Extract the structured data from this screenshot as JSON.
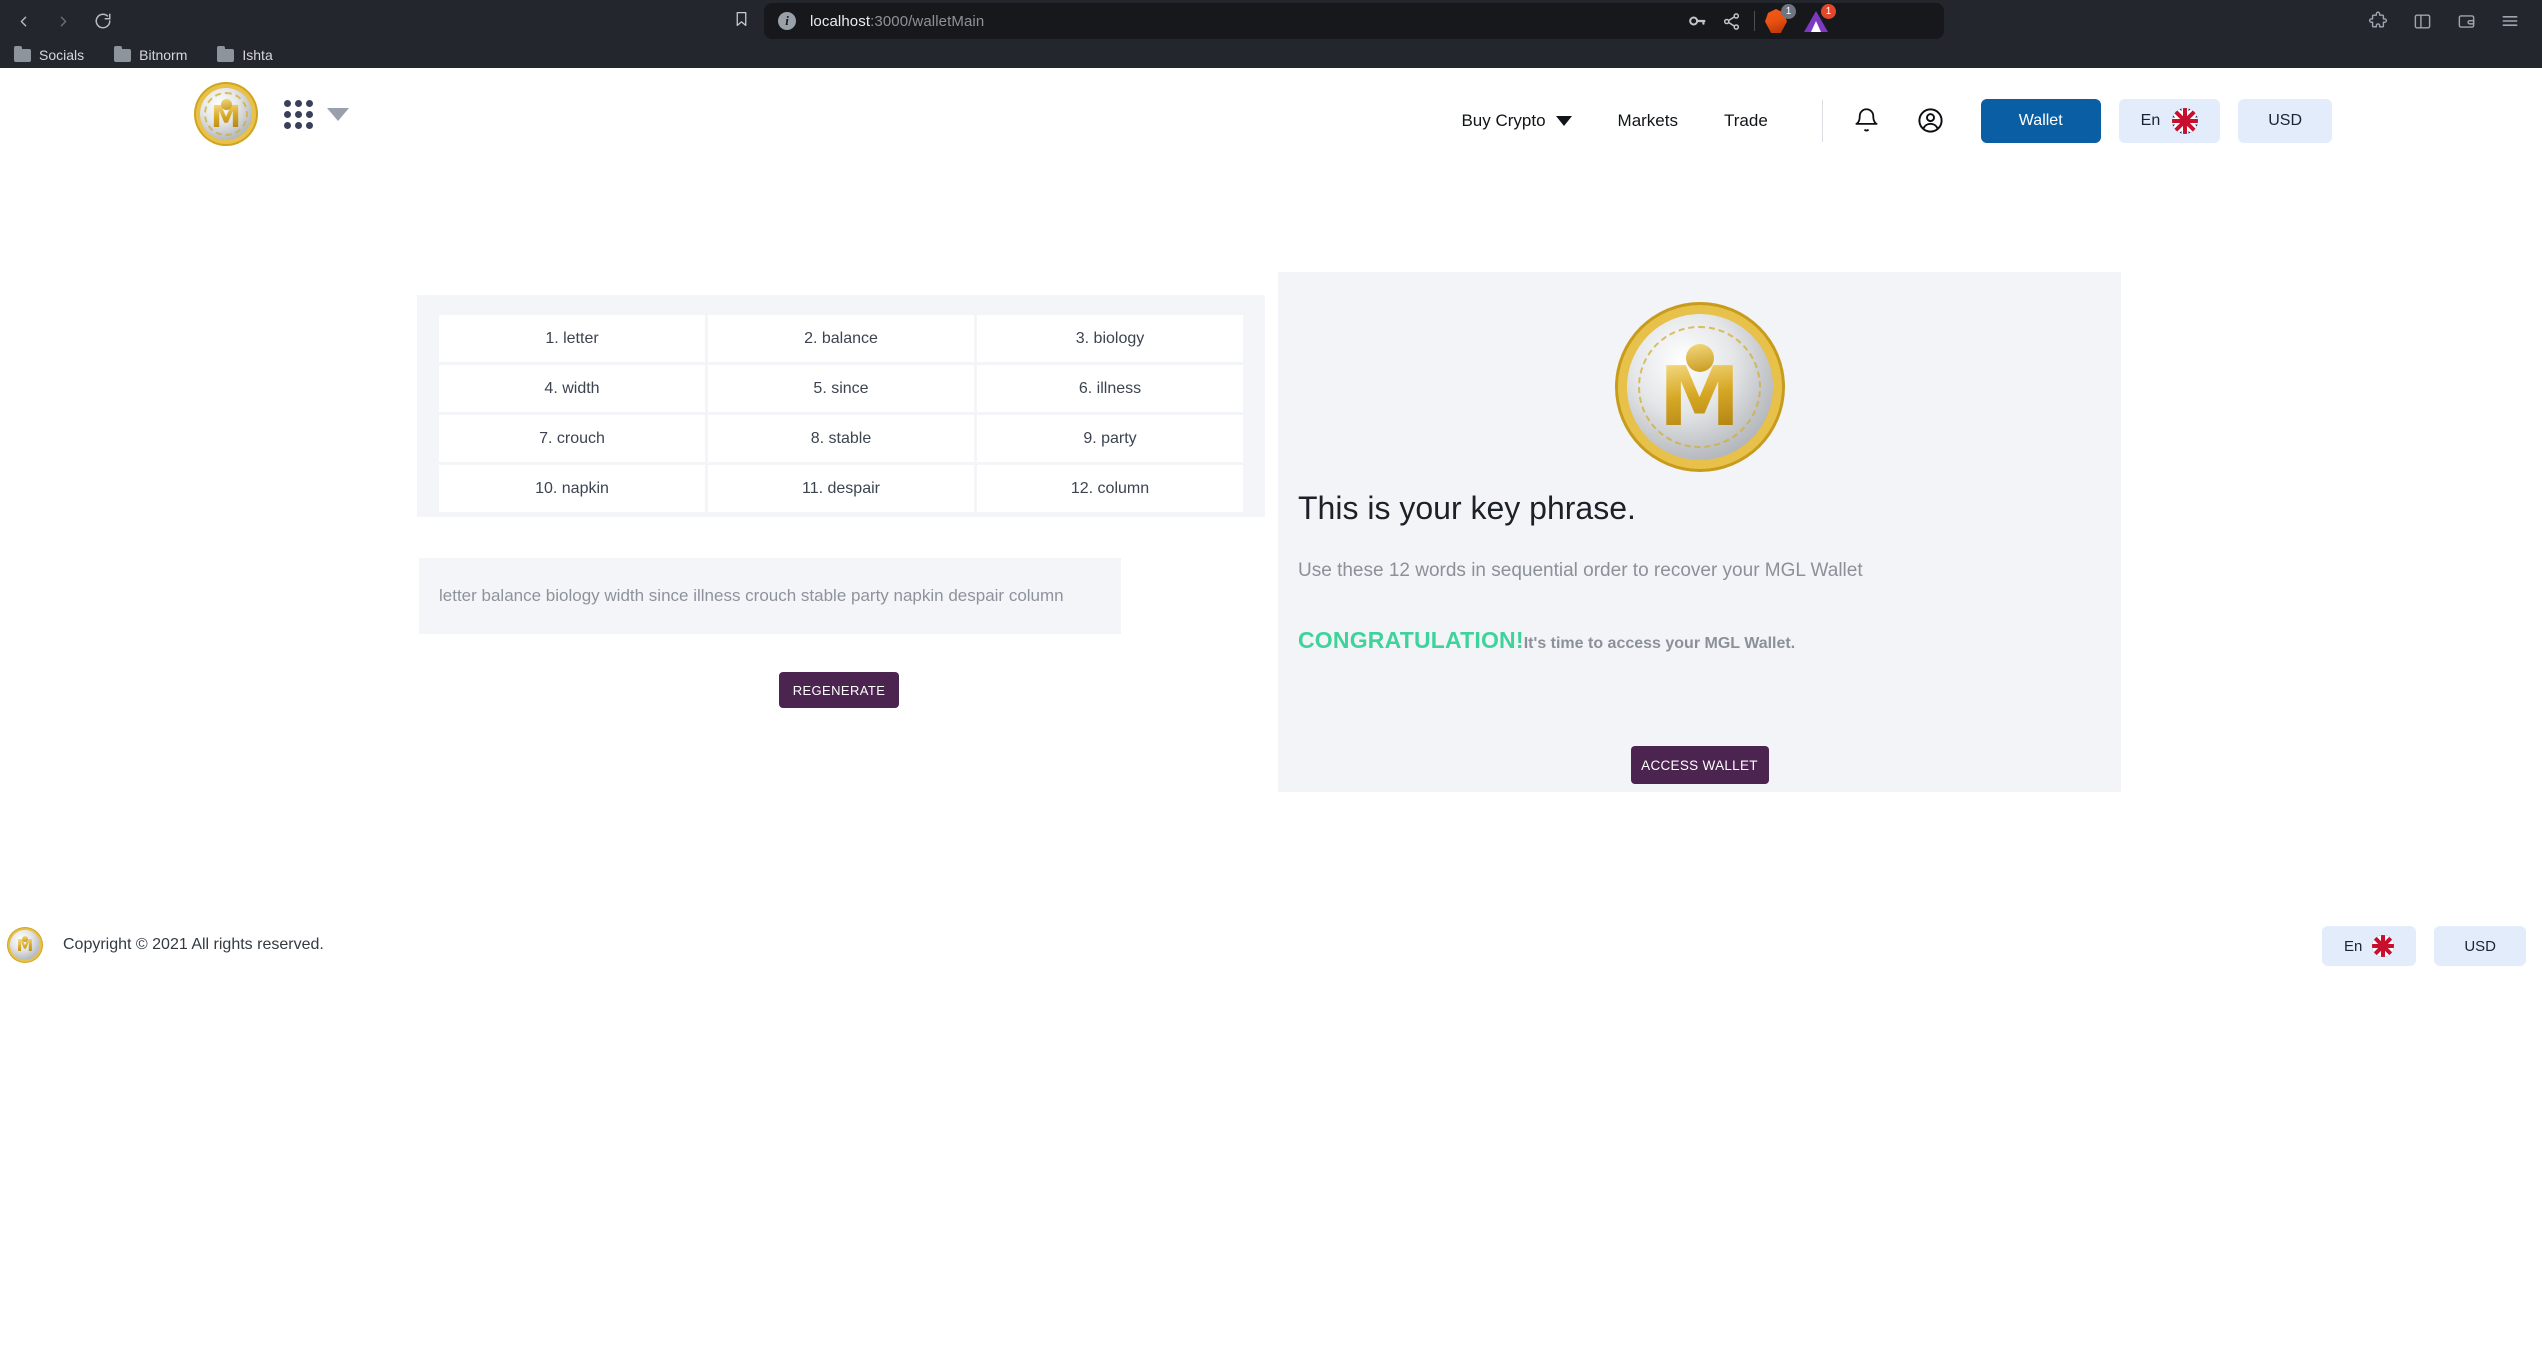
{
  "browser": {
    "back_icon": "back-arrow-icon",
    "forward_icon": "forward-arrow-icon",
    "reload_icon": "reload-icon",
    "bookmark_icon": "bookmark-icon",
    "site_info_icon": "info-icon",
    "url_host": "localhost",
    "url_path": ":3000/walletMain",
    "password_icon": "key-icon",
    "share_icon": "share-icon",
    "brave_shields_icon": "brave-lion-icon",
    "brave_badge": "1",
    "brave_badge_color": "#6e7480",
    "extension_icon": "triangle-extension-icon",
    "extension_badge": "1",
    "extension_badge_color": "#e3472b",
    "extensions_icon": "puzzle-icon",
    "sidebar_icon": "sidebar-panel-icon",
    "wallet_icon": "browser-wallet-icon",
    "menu_icon": "hamburger-menu-icon",
    "bookmarks": [
      {
        "label": "Socials",
        "icon": "folder-icon"
      },
      {
        "label": "Bitnorm",
        "icon": "folder-icon"
      },
      {
        "label": "Ishta",
        "icon": "folder-icon"
      }
    ]
  },
  "header": {
    "logo_icon": "mgl-coin-logo",
    "apps_grid_icon": "grid-menu-icon",
    "apps_caret_icon": "caret-down-icon",
    "nav": [
      {
        "label": "Buy Crypto",
        "has_caret": true
      },
      {
        "label": "Markets",
        "has_caret": false
      },
      {
        "label": "Trade",
        "has_caret": false
      }
    ],
    "notification_icon": "bell-icon",
    "account_icon": "account-circle-icon",
    "wallet_label": "Wallet",
    "language_label": "En",
    "language_flag_icon": "uk-flag-icon",
    "currency_label": "USD"
  },
  "mnemonic": {
    "words": [
      "1. letter",
      "2. balance",
      "3. biology",
      "4. width",
      "5. since",
      "6. illness",
      "7. crouch",
      "8. stable",
      "9. party",
      "10. napkin",
      "11. despair",
      "12. column"
    ],
    "phrase": "letter balance biology width since illness crouch stable party napkin despair column",
    "regenerate_label": "REGENERATE"
  },
  "key_panel": {
    "coin_icon": "mgl-coin-logo",
    "title": "This is your key phrase.",
    "subtitle": "Use these 12 words in sequential order to recover your MGL Wallet",
    "congrats": "CONGRATULATION!",
    "congrats_rest": "It's time to access your MGL Wallet.",
    "congrats_color": "#3fd39a",
    "access_label": "ACCESS WALLET"
  },
  "footer": {
    "logo_icon": "mgl-coin-logo",
    "copyright": "Copyright © 2021 All rights reserved.",
    "language_label": "En",
    "language_flag_icon": "uk-flag-icon",
    "currency_label": "USD"
  },
  "colors": {
    "brand_blue": "#0a5fa4",
    "brand_purple": "#4c2450",
    "panel_bg": "#f3f4f8",
    "success_green": "#3fd39a"
  }
}
